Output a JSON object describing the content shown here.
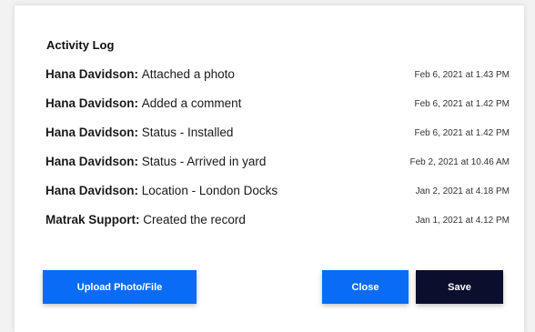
{
  "dialog": {
    "title": "Activity Log"
  },
  "activity": [
    {
      "user": "Hana Davidson",
      "action": "Attached a photo",
      "date": "Feb 6, 2021 at 1.43 PM"
    },
    {
      "user": "Hana Davidson",
      "action": "Added a comment",
      "date": "Feb 6, 2021 at 1.42 PM"
    },
    {
      "user": "Hana Davidson",
      "action": "Status - Installed",
      "date": "Feb 6, 2021 at 1.42 PM"
    },
    {
      "user": "Hana Davidson",
      "action": "Status - Arrived in yard",
      "date": "Feb 2, 2021 at 10.46 AM"
    },
    {
      "user": "Hana Davidson",
      "action": "Location - London Docks",
      "date": "Jan 2, 2021 at 4.18 PM"
    },
    {
      "user": "Matrak Support",
      "action": "Created the record",
      "date": "Jan 1, 2021 at 4.12 PM"
    }
  ],
  "buttons": {
    "upload_label": "Upload Photo/File",
    "close_label": "Close",
    "save_label": "Save"
  },
  "colors": {
    "primary": "#0a6cf5",
    "dark": "#0b0f2e"
  }
}
